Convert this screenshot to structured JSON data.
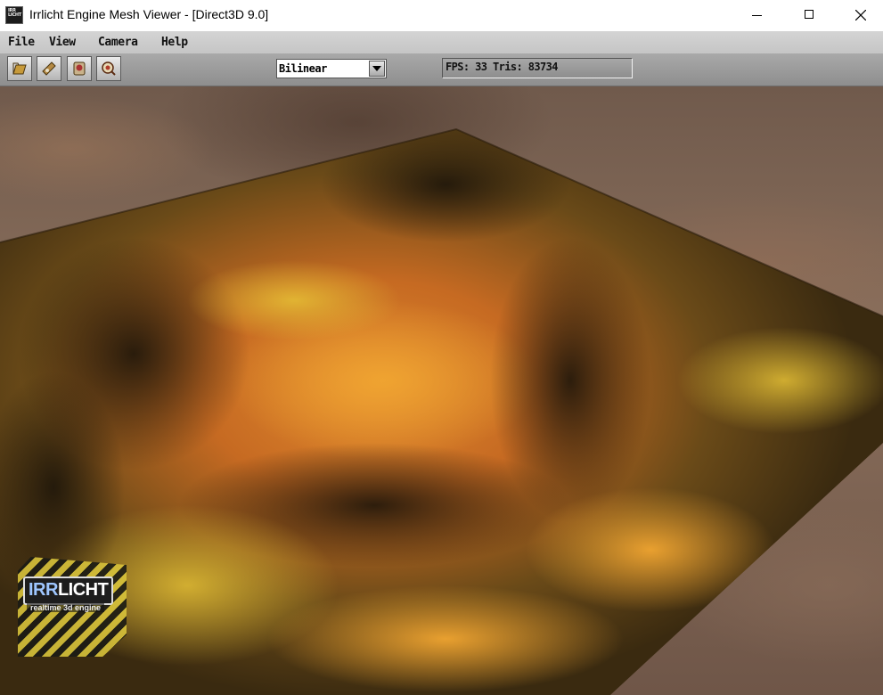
{
  "window": {
    "title": "Irrlicht Engine Mesh Viewer - [Direct3D 9.0]",
    "app_icon_text": "IRR LICHT"
  },
  "menu": [
    {
      "label": "File"
    },
    {
      "label": "View"
    },
    {
      "label": "Camera"
    },
    {
      "label": "Help"
    }
  ],
  "toolbar": {
    "buttons": [
      "open-file-icon",
      "set-model-archive-icon",
      "help-icon",
      "debug-info-icon"
    ],
    "filter": {
      "selected": "Bilinear"
    },
    "status": "FPS: 33 Tris: 83734"
  },
  "viewport": {
    "colors": {
      "terrain_light": "#d4712a",
      "terrain_dark": "#2a1d0c",
      "sky": "#7d6554"
    },
    "logo": {
      "word_a": "IRR",
      "word_b": "LICHT",
      "tagline": "realtime 3d engine"
    }
  }
}
